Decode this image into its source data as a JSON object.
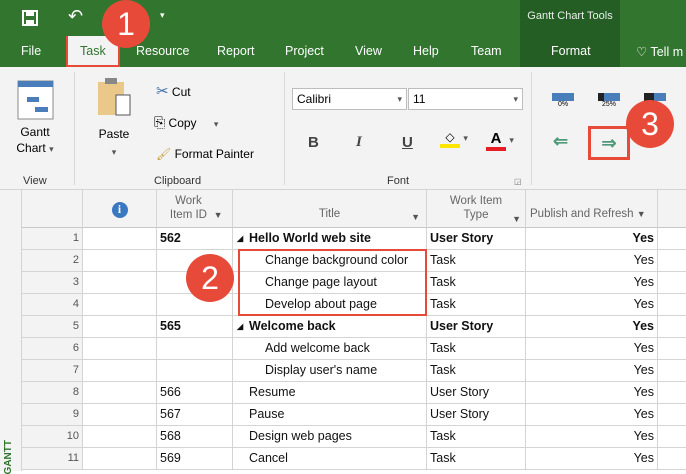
{
  "qat": {
    "save_icon": "save-icon",
    "undo_icon": "undo-icon",
    "customize_icon": "dropdown-icon"
  },
  "context_tab_group": "Gantt Chart Tools",
  "tabs": [
    "File",
    "Task",
    "Resource",
    "Report",
    "Project",
    "View",
    "Help",
    "Team",
    "Format",
    "Tell m"
  ],
  "active_tab": "Task",
  "ribbon": {
    "view": {
      "gantt_label1": "Gantt",
      "gantt_label2": "Chart",
      "group": "View"
    },
    "clipboard": {
      "paste": "Paste",
      "cut": "Cut",
      "copy": "Copy",
      "format_painter": "Format Painter",
      "group": "Clipboard"
    },
    "font": {
      "font_name": "Calibri",
      "font_size": "11",
      "bold": "B",
      "italic": "I",
      "underline": "U",
      "group": "Font",
      "highlight_color": "#ffe600",
      "font_color": "#e81c24"
    },
    "schedule": {
      "pct0": "0%",
      "pct25": "25%"
    }
  },
  "badges": [
    "1",
    "2",
    "3"
  ],
  "grid": {
    "side_label": "GANTT",
    "headers": {
      "id": "Work Item ID",
      "title": "Title",
      "type": "Work Item Type",
      "publish": "Publish and Refresh"
    },
    "rows": [
      {
        "n": "1",
        "id": "562",
        "title": "Hello World web site",
        "type": "User Story",
        "publish": "Yes",
        "summary": true,
        "indent": 0
      },
      {
        "n": "2",
        "id": "",
        "title": "Change background color",
        "type": "Task",
        "publish": "Yes",
        "summary": false,
        "indent": 2
      },
      {
        "n": "3",
        "id": "",
        "title": "Change page layout",
        "type": "Task",
        "publish": "Yes",
        "summary": false,
        "indent": 2
      },
      {
        "n": "4",
        "id": "",
        "title": "Develop about page",
        "type": "Task",
        "publish": "Yes",
        "summary": false,
        "indent": 2
      },
      {
        "n": "5",
        "id": "565",
        "title": "Welcome back",
        "type": "User Story",
        "publish": "Yes",
        "summary": true,
        "indent": 0
      },
      {
        "n": "6",
        "id": "",
        "title": "Add welcome back",
        "type": "Task",
        "publish": "Yes",
        "summary": false,
        "indent": 2
      },
      {
        "n": "7",
        "id": "",
        "title": "Display user's name",
        "type": "Task",
        "publish": "Yes",
        "summary": false,
        "indent": 2
      },
      {
        "n": "8",
        "id": "566",
        "title": "Resume",
        "type": "User Story",
        "publish": "Yes",
        "summary": false,
        "indent": 1
      },
      {
        "n": "9",
        "id": "567",
        "title": "Pause",
        "type": "User Story",
        "publish": "Yes",
        "summary": false,
        "indent": 1
      },
      {
        "n": "10",
        "id": "568",
        "title": "Design web pages",
        "type": "Task",
        "publish": "Yes",
        "summary": false,
        "indent": 1
      },
      {
        "n": "11",
        "id": "569",
        "title": "Cancel",
        "type": "Task",
        "publish": "Yes",
        "summary": false,
        "indent": 1
      }
    ]
  }
}
